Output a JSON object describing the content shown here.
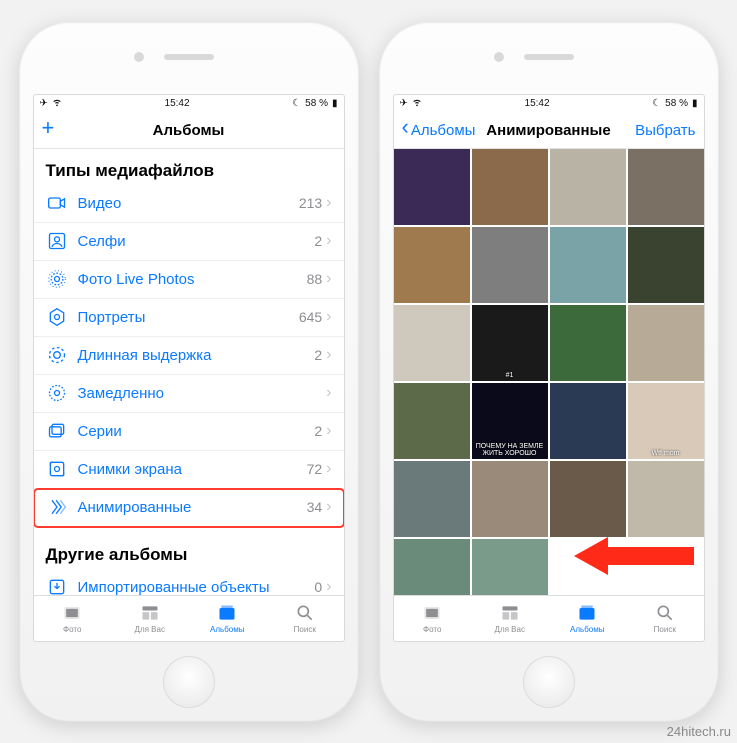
{
  "status": {
    "time": "15:42",
    "battery": "58 %",
    "plane": "✈",
    "wifi_icon": "wifi",
    "moon": "☾",
    "batt_icon": "▮"
  },
  "left": {
    "nav": {
      "add": "+",
      "title": "Альбомы"
    },
    "section1": "Типы медиафайлов",
    "rows": [
      {
        "icon": "video",
        "label": "Видео",
        "count": "213"
      },
      {
        "icon": "selfie",
        "label": "Селфи",
        "count": "2"
      },
      {
        "icon": "live",
        "label": "Фото Live Photos",
        "count": "88"
      },
      {
        "icon": "portrait",
        "label": "Портреты",
        "count": "645"
      },
      {
        "icon": "longexp",
        "label": "Длинная выдержка",
        "count": "2"
      },
      {
        "icon": "slomo",
        "label": "Замедленно",
        "count": ""
      },
      {
        "icon": "burst",
        "label": "Серии",
        "count": "2"
      },
      {
        "icon": "screenshot",
        "label": "Снимки экрана",
        "count": "72"
      },
      {
        "icon": "animated",
        "label": "Анимированные",
        "count": "34",
        "highlight": true
      }
    ],
    "section2": "Другие альбомы",
    "rows2": [
      {
        "icon": "import",
        "label": "Импортированные объекты",
        "count": "0"
      }
    ]
  },
  "right": {
    "nav": {
      "back": "Альбомы",
      "title": "Анимированные",
      "select": "Выбрать"
    },
    "thumbs": [
      {
        "bg": "#3a2a55"
      },
      {
        "bg": "#8a6a4a"
      },
      {
        "bg": "#b9b3a6"
      },
      {
        "bg": "#7a7063"
      },
      {
        "bg": "#a07a4f"
      },
      {
        "bg": "#7e7e7e"
      },
      {
        "bg": "#7aa3a8"
      },
      {
        "bg": "#39432f"
      },
      {
        "bg": "#cfc8bd"
      },
      {
        "bg": "#1a1a1a",
        "txt": "#1"
      },
      {
        "bg": "#3d6a3a"
      },
      {
        "bg": "#b7aa96"
      },
      {
        "bg": "#5d6a4a"
      },
      {
        "bg": "#0a0a1a",
        "txt": "ПОЧЕМУ НА ЗЕМЛЕ ЖИТЬ ХОРОШО"
      },
      {
        "bg": "#2a3a55"
      },
      {
        "bg": "#d8c9b8",
        "txt": "Wtf mom"
      },
      {
        "bg": "#6a7a7a"
      },
      {
        "bg": "#9a8a7a"
      },
      {
        "bg": "#6a5a4a"
      },
      {
        "bg": "#c0b8a8"
      },
      {
        "bg": "#6a8a7a"
      },
      {
        "bg": "#7a9a8a"
      },
      {
        "bg": "#ffffff"
      },
      {
        "bg": "#ffffff"
      }
    ]
  },
  "tabs": [
    {
      "key": "photos",
      "label": "Фото"
    },
    {
      "key": "foryou",
      "label": "Для Вас"
    },
    {
      "key": "albums",
      "label": "Альбомы",
      "active": true
    },
    {
      "key": "search",
      "label": "Поиск"
    }
  ],
  "watermark": "24hitech.ru"
}
